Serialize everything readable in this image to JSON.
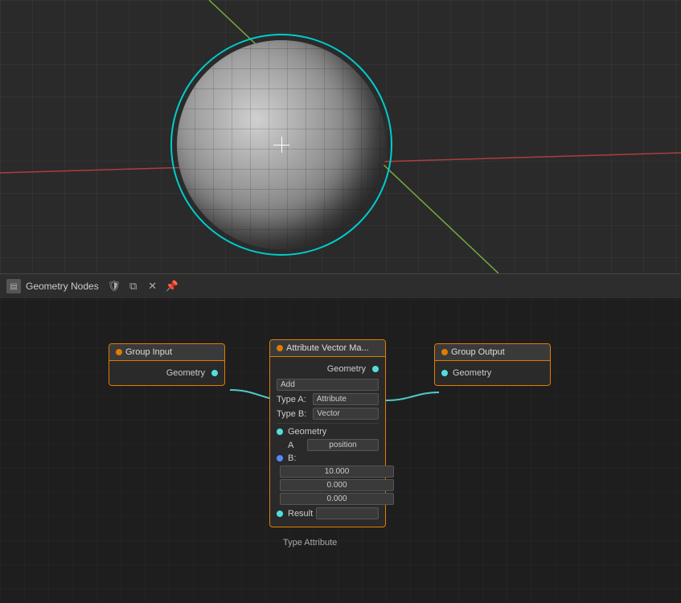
{
  "viewport": {
    "bg_color": "#2a2a2a"
  },
  "header": {
    "icon": "▤",
    "title": "Geometry Nodes",
    "btn_shield": "🛡",
    "btn_copy": "⧉",
    "btn_close": "✕",
    "btn_pin": "📌"
  },
  "nodes": {
    "group_input": {
      "title": "Group Input",
      "geometry_label": "Geometry"
    },
    "group_output": {
      "title": "Group Output",
      "geometry_label": "Geometry"
    },
    "attr_vec_math": {
      "title": "Attribute Vector Ma...",
      "geometry_label": "Geometry",
      "operation_label": "Add",
      "type_a_label": "Type A:",
      "type_a_value": "Attribute",
      "type_b_label": "Type B:",
      "type_b_value": "Vector",
      "geometry_input_label": "Geometry",
      "a_label": "A",
      "a_value": "position",
      "b_label": "B:",
      "b_x": "10.000",
      "b_y": "0.000",
      "b_z": "0.000",
      "result_label": "Result",
      "type_attribute_label": "Type Attribute"
    }
  }
}
